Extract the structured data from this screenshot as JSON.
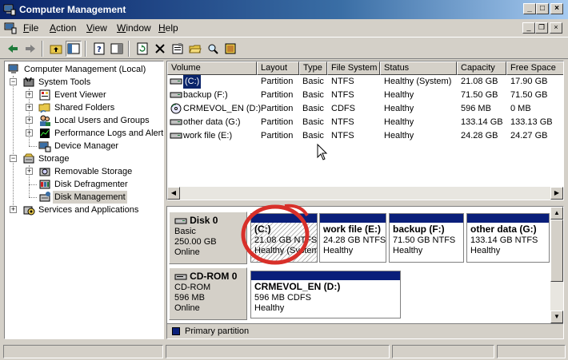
{
  "window": {
    "title": "Computer Management"
  },
  "menu": [
    {
      "label": "File",
      "accel": "F"
    },
    {
      "label": "Action",
      "accel": "A"
    },
    {
      "label": "View",
      "accel": "V"
    },
    {
      "label": "Window",
      "accel": "W"
    },
    {
      "label": "Help",
      "accel": "H"
    }
  ],
  "tree": {
    "root": "Computer Management (Local)",
    "system_tools": "System Tools",
    "event_viewer": "Event Viewer",
    "shared_folders": "Shared Folders",
    "local_users": "Local Users and Groups",
    "perf_logs": "Performance Logs and Alerts",
    "device_manager": "Device Manager",
    "storage": "Storage",
    "removable_storage": "Removable Storage",
    "disk_defrag": "Disk Defragmenter",
    "disk_management": "Disk Management",
    "services_apps": "Services and Applications"
  },
  "list": {
    "columns": [
      "Volume",
      "Layout",
      "Type",
      "File System",
      "Status",
      "Capacity",
      "Free Space"
    ],
    "rows": [
      {
        "volume": "(C:)",
        "layout": "Partition",
        "type": "Basic",
        "fs": "NTFS",
        "status": "Healthy (System)",
        "capacity": "21.08 GB",
        "free": "17.90 GB"
      },
      {
        "volume": "backup (F:)",
        "layout": "Partition",
        "type": "Basic",
        "fs": "NTFS",
        "status": "Healthy",
        "capacity": "71.50 GB",
        "free": "71.50 GB"
      },
      {
        "volume": "CRMEVOL_EN (D:)",
        "layout": "Partition",
        "type": "Basic",
        "fs": "CDFS",
        "status": "Healthy",
        "capacity": "596 MB",
        "free": "0 MB"
      },
      {
        "volume": "other data (G:)",
        "layout": "Partition",
        "type": "Basic",
        "fs": "NTFS",
        "status": "Healthy",
        "capacity": "133.14 GB",
        "free": "133.13 GB"
      },
      {
        "volume": "work file (E:)",
        "layout": "Partition",
        "type": "Basic",
        "fs": "NTFS",
        "status": "Healthy",
        "capacity": "24.28 GB",
        "free": "24.27 GB"
      }
    ]
  },
  "disks": {
    "disk0": {
      "name": "Disk 0",
      "type": "Basic",
      "size": "250.00 GB",
      "state": "Online",
      "partitions": [
        {
          "name": "(C:)",
          "info": "21.08 GB NTFS",
          "status": "Healthy (System)"
        },
        {
          "name": "work file  (E:)",
          "info": "24.28 GB NTFS",
          "status": "Healthy"
        },
        {
          "name": "backup  (F:)",
          "info": "71.50 GB NTFS",
          "status": "Healthy"
        },
        {
          "name": "other data  (G:)",
          "info": "133.14 GB NTFS",
          "status": "Healthy"
        }
      ]
    },
    "cdrom0": {
      "name": "CD-ROM 0",
      "type": "CD-ROM",
      "size": "596 MB",
      "state": "Online",
      "partitions": [
        {
          "name": "CRMEVOL_EN  (D:)",
          "info": "596 MB CDFS",
          "status": "Healthy"
        }
      ]
    }
  },
  "legend": {
    "primary": "Primary partition"
  },
  "colors": {
    "title_start": "#0a246a",
    "partition_bar": "#0a1f7a",
    "annotation": "#d8302a"
  }
}
